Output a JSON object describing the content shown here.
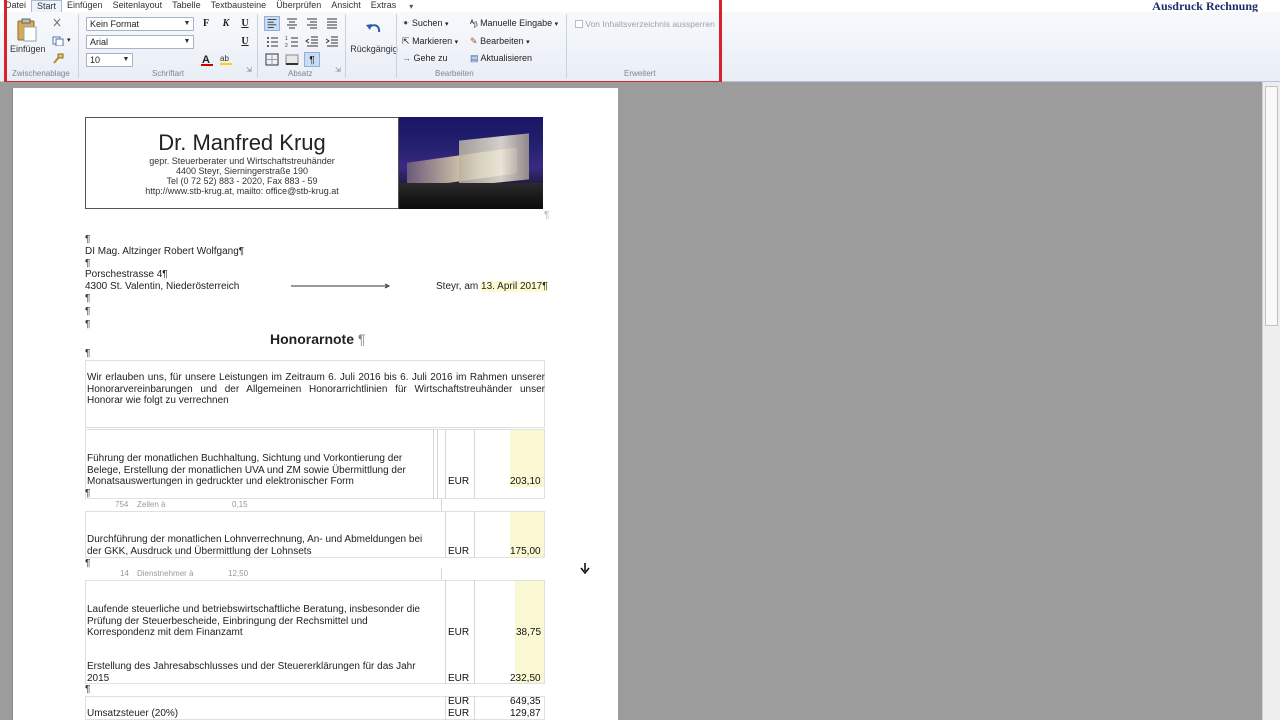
{
  "menu": {
    "items": [
      "Datei",
      "Start",
      "Einfügen",
      "Seitenlayout",
      "Tabelle",
      "Textbausteine",
      "Überprüfen",
      "Ansicht",
      "Extras"
    ],
    "more": "▾",
    "doc_title": "Ausdruck Rechnung"
  },
  "ribbon": {
    "clipboard": {
      "paste_label": "Einfügen",
      "group_label": "Zwischenablage"
    },
    "font": {
      "style_value": "Kein Format",
      "font_value": "Arial",
      "size_value": "10",
      "bold": "F",
      "italic": "K",
      "underline": "U",
      "group_label": "Schriftart"
    },
    "paragraph": {
      "group_label": "Absatz",
      "pilcrow": "¶"
    },
    "undo": {
      "label": "Rückgängig"
    },
    "edit": {
      "search": "Suchen",
      "select": "Markieren",
      "goto": "Gehe zu",
      "manual_input": "Manuelle Eingabe",
      "edit": "Bearbeiten",
      "refresh": "Aktualisieren",
      "group_label": "Bearbeiten"
    },
    "extended": {
      "lock_label": "Von Inhaltsverzeichnis aussperren",
      "group_label": "Erweitert"
    }
  },
  "letterhead": {
    "name": "Dr. Manfred Krug",
    "subtitle": "gepr. Steuerberater und Wirtschaftstreuhänder",
    "address": "4400 Steyr, Sierningerstraße 190",
    "phone": "Tel (0 72 52) 883 - 2020, Fax 883 - 59",
    "web": "http://www.stb-krug.at, mailto: office@stb-krug.at"
  },
  "recipient": {
    "name": "DI Mag. Altzinger Robert Wolfgang¶",
    "street": "Porschestrasse 4¶",
    "city": "4300 St. Valentin, Niederösterreich",
    "place": "Steyr, am",
    "date": "13. April 2017¶"
  },
  "document": {
    "heading": "Honorarnote",
    "pilcrow": "¶",
    "intro": "Wir erlauben uns, für unsere Leistungen im Zeitraum 6. Juli 2016 bis 6. Juli 2016 im Rahmen unserer Honorarvereinbarungen und der Allgemeinen Honorarrichtlinien für Wirtschaftstreuhänder unser Honorar wie folgt zu verrechnen"
  },
  "items": [
    {
      "text": "Führung der monatlichen Buchhaltung, Sichtung und Vorkontierung der Belege, Erstellung der monatlichen UVA und ZM sowie Übermittlung der Monatsauswertungen in gedruckter und elektronischer Form",
      "currency": "EUR",
      "amount": "203,10",
      "sub_qty": "754",
      "sub_unit": "Zeilen à",
      "sub_price": "0,15"
    },
    {
      "text": "Durchführung der monatlichen Lohnverrechnung, An- und Abmeldungen bei der GKK, Ausdruck und Übermittlung der Lohnsets",
      "currency": "EUR",
      "amount": "175,00",
      "sub_qty": "14",
      "sub_unit": "Dienstnehmer à",
      "sub_price": "12,50"
    },
    {
      "text": "Laufende steuerliche und betriebswirtschaftliche Beratung, insbesonder die Prüfung der Steuerbescheide, Einbringung der Rechsmittel und Korrespondenz mit dem Finanzamt",
      "currency": "EUR",
      "amount": "38,75"
    },
    {
      "text": "Erstellung des Jahresabschlusses und der Steuererklärungen für das Jahr 2015",
      "currency": "EUR",
      "amount": "232,50"
    }
  ],
  "totals": {
    "sum_currency": "EUR",
    "sum_amount": "649,35",
    "vat_label": "Umsatzsteuer (20%)",
    "vat_currency": "EUR",
    "vat_amount": "129,87"
  }
}
